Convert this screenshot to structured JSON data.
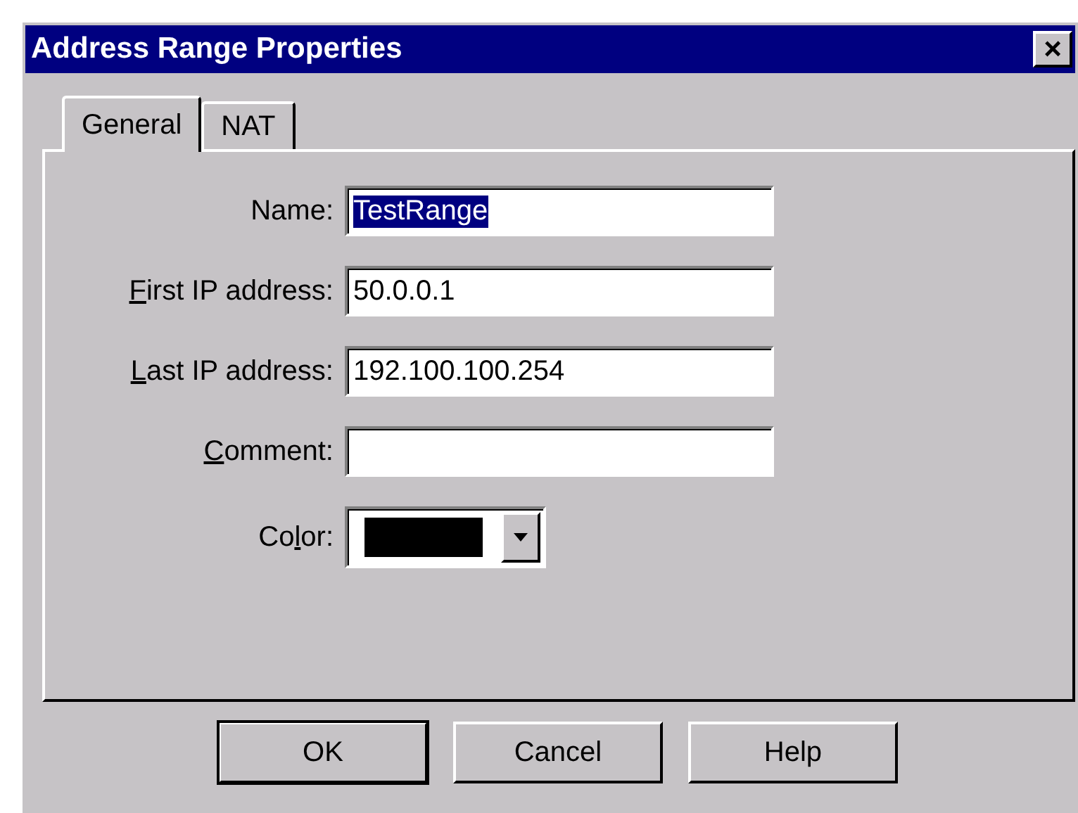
{
  "window": {
    "title": "Address Range Properties",
    "close_label": "×"
  },
  "tabs": [
    {
      "label": "General",
      "selected": true
    },
    {
      "label": "NAT",
      "selected": false
    }
  ],
  "fields": [
    {
      "kind": "text",
      "label": [
        {
          "text": "Name:",
          "underlined": false
        }
      ],
      "value": "TestRange",
      "text_selected": true
    },
    {
      "kind": "text",
      "label": [
        {
          "text": "F",
          "underlined": true
        },
        {
          "text": "irst IP address:",
          "underlined": false
        }
      ],
      "value": "50.0.0.1",
      "text_selected": false
    },
    {
      "kind": "text",
      "label": [
        {
          "text": "L",
          "underlined": true
        },
        {
          "text": "ast IP address:",
          "underlined": false
        }
      ],
      "value": "192.100.100.254",
      "text_selected": false
    },
    {
      "kind": "text",
      "label": [
        {
          "text": "C",
          "underlined": true
        },
        {
          "text": "omment:",
          "underlined": false
        }
      ]
    },
    {
      "kind": "color",
      "label": [
        {
          "text": "Co",
          "underlined": false
        },
        {
          "text": "l",
          "underlined": true
        },
        {
          "text": "or:",
          "underlined": false
        }
      ],
      "color": "#000000"
    }
  ],
  "buttons": [
    {
      "label": "OK",
      "default": true
    },
    {
      "label": "Cancel",
      "default": false
    },
    {
      "label": "Help",
      "default": false
    }
  ]
}
